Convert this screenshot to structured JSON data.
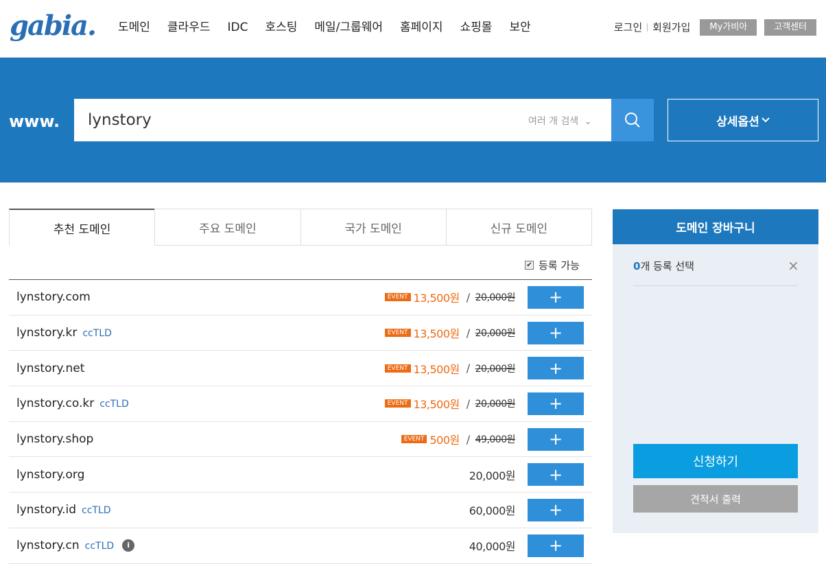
{
  "header": {
    "logo": "gabia.",
    "nav": [
      "도메인",
      "클라우드",
      "IDC",
      "호스팅",
      "메일/그룹웨어",
      "홈페이지",
      "쇼핑몰",
      "보안"
    ],
    "login": "로그인",
    "signup": "회원가입",
    "my_gabia": "My가비아",
    "support": "고객센터"
  },
  "search": {
    "prefix": "www.",
    "value": "lynstory",
    "multi_label": "여러 개 검색",
    "detail_label": "상세옵션"
  },
  "tabs": [
    "추천 도메인",
    "주요 도메인",
    "국가 도메인",
    "신규 도메인"
  ],
  "filter_label": "등록 가능",
  "domains": [
    {
      "name": "lynstory.com",
      "tag": "",
      "event": "EVENT",
      "price": "13,500원",
      "orig": "20,000원"
    },
    {
      "name": "lynstory.kr",
      "tag": "ccTLD",
      "event": "EVENT",
      "price": "13,500원",
      "orig": "20,000원"
    },
    {
      "name": "lynstory.net",
      "tag": "",
      "event": "EVENT",
      "price": "13,500원",
      "orig": "20,000원"
    },
    {
      "name": "lynstory.co.kr",
      "tag": "ccTLD",
      "event": "EVENT",
      "price": "13,500원",
      "orig": "20,000원"
    },
    {
      "name": "lynstory.shop",
      "tag": "",
      "event": "EVENT",
      "price": "500원",
      "orig": "49,000원"
    },
    {
      "name": "lynstory.org",
      "tag": "",
      "event": "",
      "price": "20,000원",
      "orig": ""
    },
    {
      "name": "lynstory.id",
      "tag": "ccTLD",
      "event": "",
      "price": "60,000원",
      "orig": ""
    },
    {
      "name": "lynstory.cn",
      "tag": "ccTLD",
      "event": "",
      "price": "40,000원",
      "orig": "",
      "info": "i"
    }
  ],
  "add_symbol": "+",
  "slash": "/",
  "cart": {
    "title": "도메인 장바구니",
    "count": "0",
    "count_suffix": "개 등록 선택",
    "close": "×",
    "apply": "신청하기",
    "quote": "견적서 출력"
  },
  "colors": {
    "brand_blue": "#1e78be",
    "event_orange": "#ec6b14",
    "button_blue": "#2f8fd8"
  }
}
